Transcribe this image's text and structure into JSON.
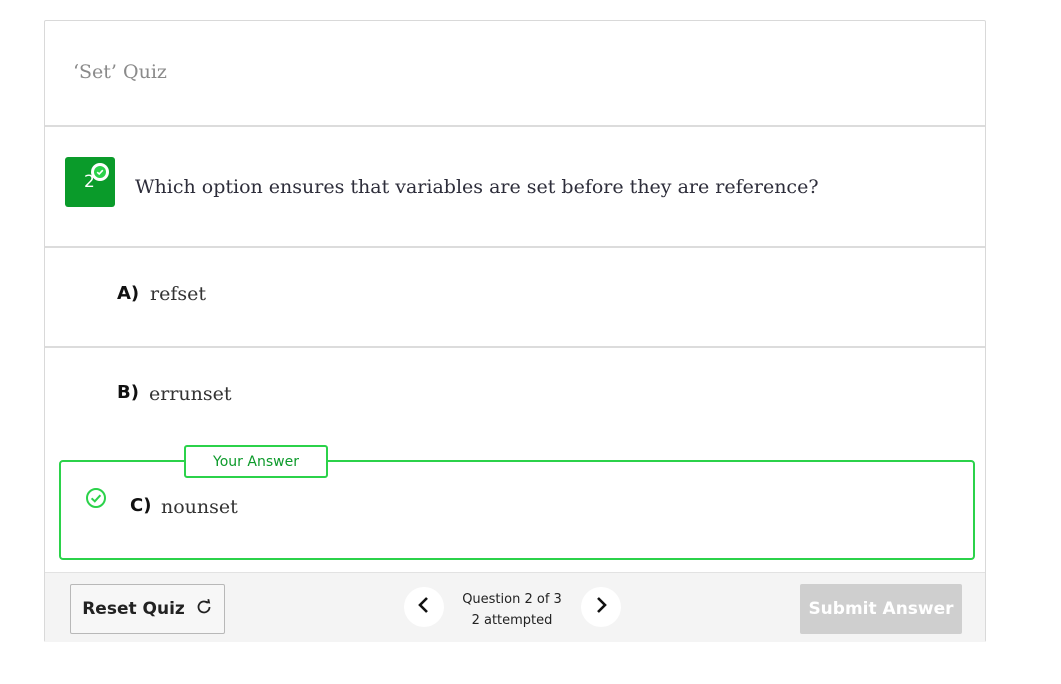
{
  "quiz": {
    "title": "‘Set’ Quiz",
    "question_number": "2",
    "question_text": "Which option ensures that variables are set before they are reference?",
    "options": [
      {
        "label": "A)",
        "text": "refset"
      },
      {
        "label": "B)",
        "text": "errunset"
      },
      {
        "label": "C)",
        "text": "nounset"
      }
    ],
    "your_answer_label": "Your Answer",
    "colors": {
      "accent_green": "#0a9b2a",
      "answer_border": "#2bd24a",
      "submit_disabled": "#cfcfcf"
    }
  },
  "footer": {
    "reset_label": "Reset Quiz",
    "question_progress": "Question 2 of 3",
    "attempted": "2 attempted",
    "submit_label": "Submit Answer"
  }
}
